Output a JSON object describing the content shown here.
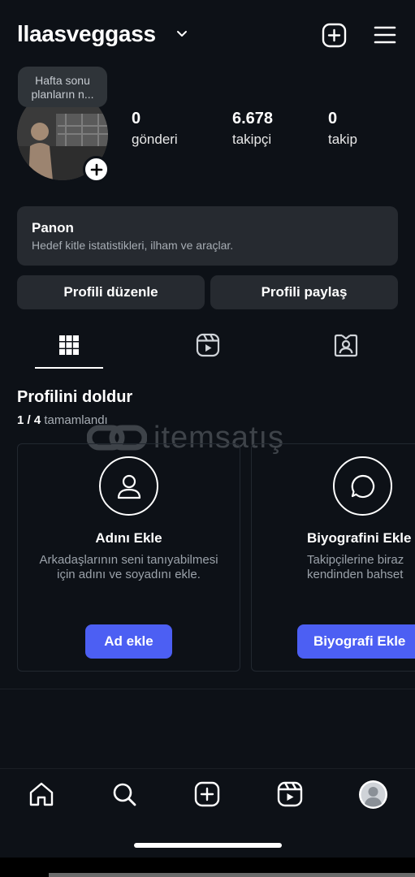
{
  "header": {
    "username": "llaasveggass"
  },
  "profile": {
    "note": "Hafta sonu planların n...",
    "stats": [
      {
        "value": "0",
        "label": "gönderi"
      },
      {
        "value": "6.678",
        "label": "takipçi"
      },
      {
        "value": "0",
        "label": "takip"
      }
    ]
  },
  "dashboard": {
    "title": "Panon",
    "subtitle": "Hedef kitle istatistikleri, ilham ve araçlar."
  },
  "actions": {
    "edit_profile": "Profili düzenle",
    "share_profile": "Profili paylaş"
  },
  "tabs": {
    "selected": "grid"
  },
  "complete_profile": {
    "title": "Profilini doldur",
    "progress_fraction": "1 / 4",
    "progress_text": "tamamlandı",
    "cards": [
      {
        "title": "Adını Ekle",
        "description_line1": "Arkadaşlarının seni tanıyabilmesi",
        "description_line2": "için adını ve soyadını ekle.",
        "button": "Ad ekle"
      },
      {
        "title": "Biyografini Ekle",
        "description_line1": "Takipçilerine biraz",
        "description_line2": "kendinden bahset",
        "button": "Biyografi Ekle"
      }
    ]
  },
  "watermark": {
    "text": "itemsatış"
  },
  "colors": {
    "background": "#0d1117",
    "card": "#262a30",
    "accent": "#4c5ff3"
  }
}
